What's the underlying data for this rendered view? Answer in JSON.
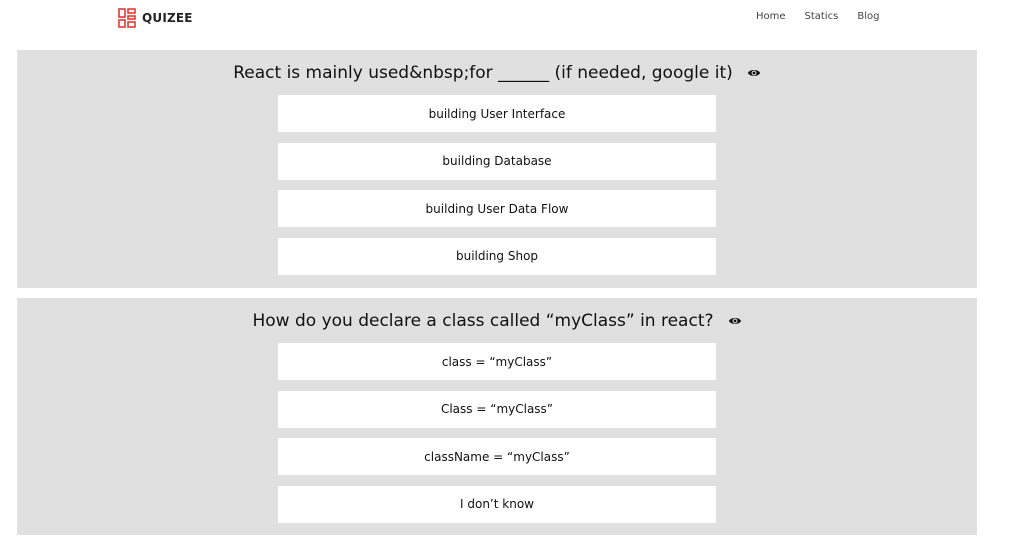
{
  "navbar": {
    "brand": "QUIZEE",
    "links": [
      "Home",
      "Statics",
      "Blog"
    ],
    "accent_color": "#e53935"
  },
  "questions": [
    {
      "text": "React is mainly used&nbsp;for ______ (if needed, google it)",
      "toggle_icon": "eye-icon",
      "options": [
        "building User Interface",
        "building Database",
        "building User Data Flow",
        "building Shop"
      ]
    },
    {
      "text": "How do you declare a class called “myClass” in react?",
      "toggle_icon": "eye-icon",
      "options": [
        "class = “myClass”",
        "Class = “myClass”",
        "className = “myClass”",
        "I don’t know"
      ]
    }
  ]
}
